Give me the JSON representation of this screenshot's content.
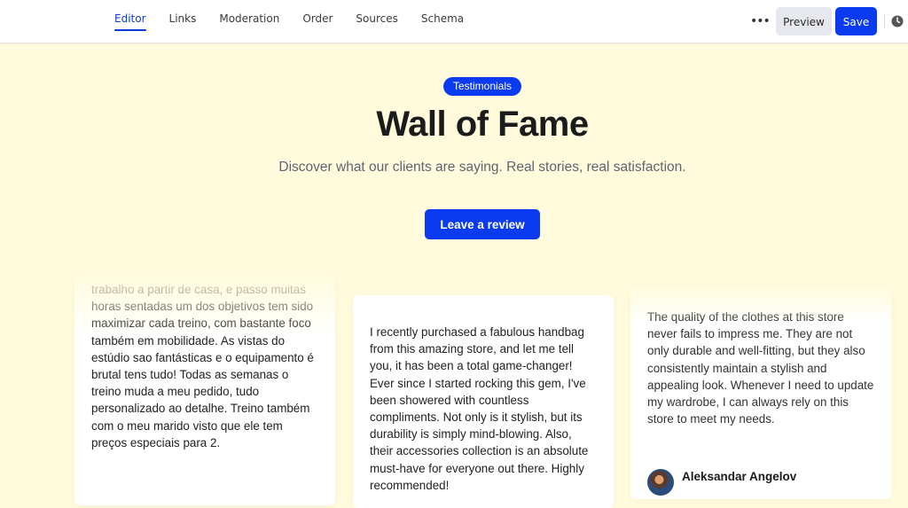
{
  "toolbar": {
    "tabs": [
      "Editor",
      "Links",
      "Moderation",
      "Order",
      "Sources",
      "Schema"
    ],
    "active_tab": "Editor",
    "more_label": "•••",
    "preview_label": "Preview",
    "save_label": "Save",
    "accent_color": "#0b3bf0"
  },
  "hero": {
    "badge": "Testimonials",
    "title": "Wall of Fame",
    "subtitle": "Discover what our clients are saying. Real stories, real satisfaction.",
    "cta_label": "Leave a review",
    "background_color": "#fffbdc"
  },
  "reviews": [
    {
      "text": "trabalho a partir de casa, e passo muitas horas sentadas um dos objetivos tem sido maximizar cada treino, com bastante foco também em mobilidade. As vistas do estúdio sao fantásticas e o equipamento é brutal tens tudo! Todas as semanas o treino muda a meu pedido, tudo personalizado ao detalhe. Treino também com o meu marido visto que ele tem preços especiais para 2."
    },
    {
      "text": "I recently purchased a fabulous handbag from this amazing store, and let me tell you, it has been a total game-changer! Ever since I started rocking this gem, I've been showered with countless compliments. Not only is it stylish, but its durability is simply mind-blowing. Also, their accessories collection is an absolute must-have for everyone out there. Highly recommended!"
    },
    {
      "text": "The quality of the clothes at this store never fails to impress me. They are not only durable and well-fitting, but they also consistently maintain a stylish and appealing look. Whenever I need to update my wardrobe, I can always rely on this store to meet my needs.",
      "author": "Aleksandar Angelov"
    }
  ]
}
